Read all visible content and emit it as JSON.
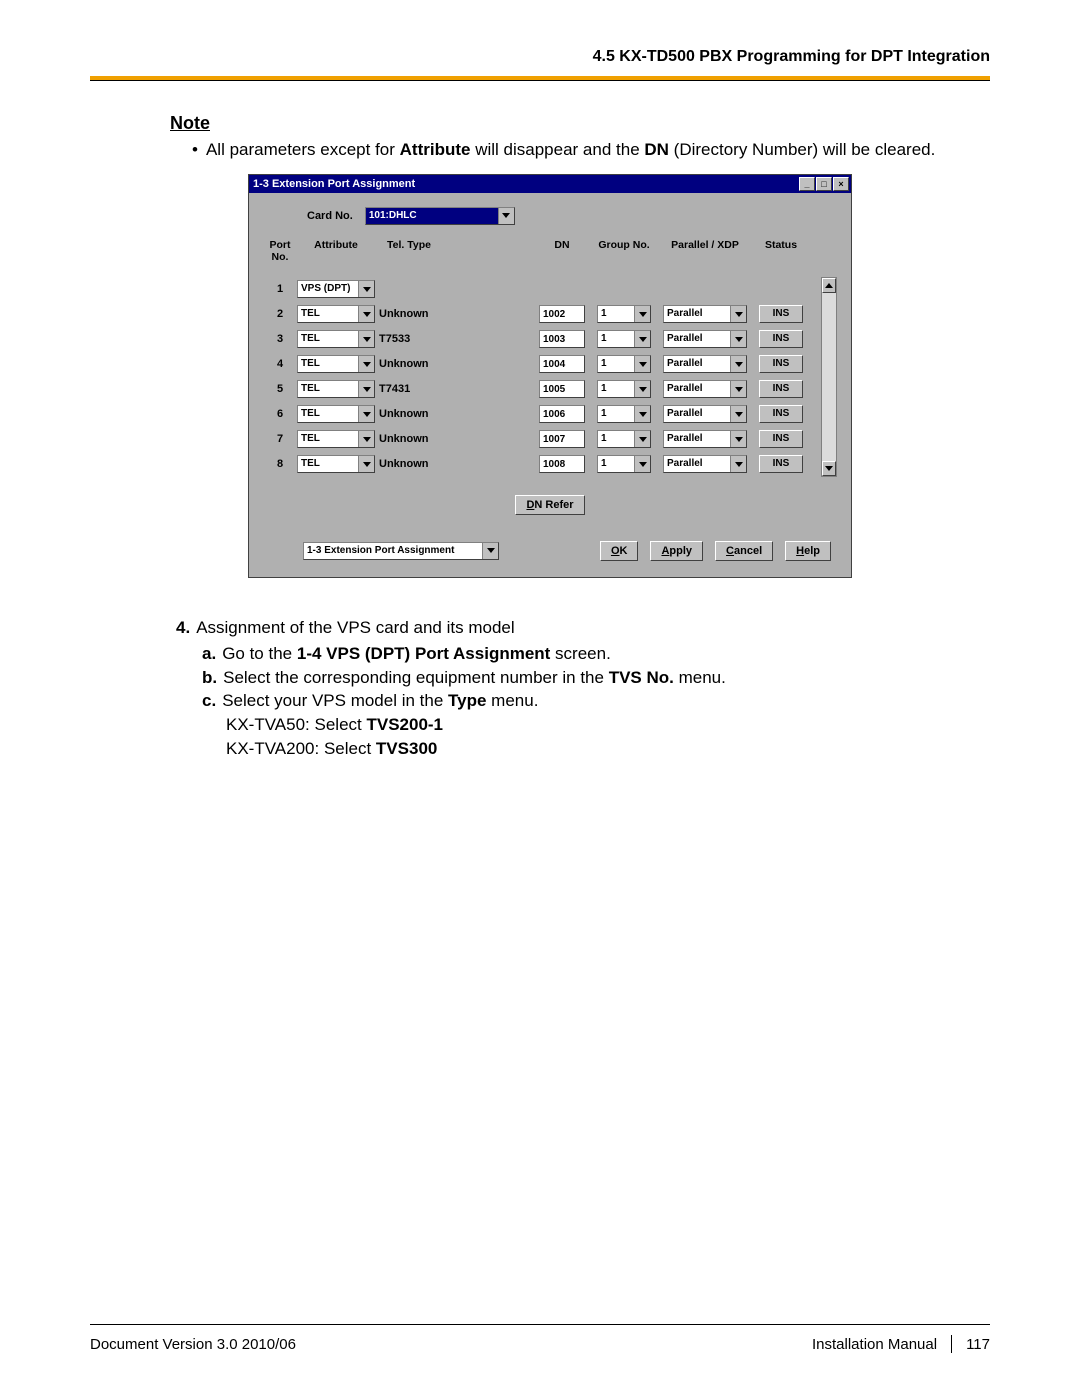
{
  "header": {
    "section": "4.5 KX-TD500 PBX Programming for DPT Integration"
  },
  "note": {
    "heading": "Note",
    "bullet": "All parameters except for ",
    "bold1": "Attribute",
    "mid": " will disappear and the ",
    "bold2": "DN",
    "tail": " (Directory Number) will be cleared."
  },
  "window": {
    "title": "1-3 Extension Port Assignment",
    "card_label": "Card No.",
    "card_value": "101:DHLC",
    "headers": {
      "port": "Port No.",
      "attribute": "Attribute",
      "teltype": "Tel. Type",
      "dn": "DN",
      "group": "Group No.",
      "pxdp": "Parallel / XDP",
      "status": "Status"
    },
    "rows": [
      {
        "port": "1",
        "attribute": "VPS (DPT)",
        "teltype": "",
        "dn": "",
        "group": "",
        "pxdp": "",
        "status": ""
      },
      {
        "port": "2",
        "attribute": "TEL",
        "teltype": "Unknown",
        "dn": "1002",
        "group": "1",
        "pxdp": "Parallel",
        "status": "INS"
      },
      {
        "port": "3",
        "attribute": "TEL",
        "teltype": "T7533",
        "dn": "1003",
        "group": "1",
        "pxdp": "Parallel",
        "status": "INS"
      },
      {
        "port": "4",
        "attribute": "TEL",
        "teltype": "Unknown",
        "dn": "1004",
        "group": "1",
        "pxdp": "Parallel",
        "status": "INS"
      },
      {
        "port": "5",
        "attribute": "TEL",
        "teltype": "T7431",
        "dn": "1005",
        "group": "1",
        "pxdp": "Parallel",
        "status": "INS"
      },
      {
        "port": "6",
        "attribute": "TEL",
        "teltype": "Unknown",
        "dn": "1006",
        "group": "1",
        "pxdp": "Parallel",
        "status": "INS"
      },
      {
        "port": "7",
        "attribute": "TEL",
        "teltype": "Unknown",
        "dn": "1007",
        "group": "1",
        "pxdp": "Parallel",
        "status": "INS"
      },
      {
        "port": "8",
        "attribute": "TEL",
        "teltype": "Unknown",
        "dn": "1008",
        "group": "1",
        "pxdp": "Parallel",
        "status": "INS"
      }
    ],
    "dn_refer": "DN Refer",
    "footer_combo": "1-3 Extension Port Assignment",
    "buttons": {
      "ok": "OK",
      "apply": "Apply",
      "cancel": "Cancel",
      "help": "Help"
    }
  },
  "step4": {
    "num": "4.",
    "text": "Assignment of the VPS card and its model",
    "a": {
      "let": "a.",
      "pre": "Go to the ",
      "bold": "1-4 VPS (DPT) Port Assignment",
      "post": " screen."
    },
    "b": {
      "let": "b.",
      "pre": "Select the corresponding equipment number in the ",
      "bold": "TVS No.",
      "post": " menu."
    },
    "c": {
      "let": "c.",
      "pre": "Select your VPS model in the ",
      "bold": "Type",
      "post": " menu."
    },
    "c_line1_pre": "KX-TVA50: Select ",
    "c_line1_bold": "TVS200-1",
    "c_line2_pre": "KX-TVA200: Select ",
    "c_line2_bold": "TVS300"
  },
  "footer": {
    "left": "Document Version  3.0  2010/06",
    "right_label": "Installation Manual",
    "page": "117"
  }
}
